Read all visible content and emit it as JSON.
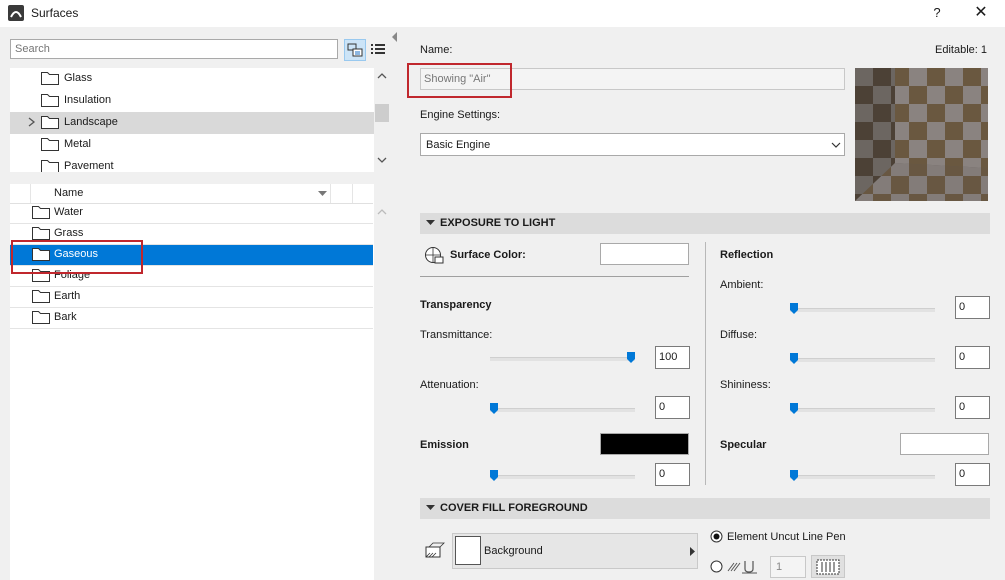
{
  "window": {
    "title": "Surfaces",
    "help": "?",
    "close": "✕"
  },
  "left": {
    "search_placeholder": "Search",
    "tree": [
      {
        "label": "Glass",
        "expandable": false
      },
      {
        "label": "Insulation",
        "expandable": false
      },
      {
        "label": "Landscape",
        "expandable": true,
        "highlighted": true
      },
      {
        "label": "Metal",
        "expandable": false
      },
      {
        "label": "Pavement",
        "expandable": false
      }
    ],
    "list_header": "Name",
    "list": [
      {
        "label": "Water",
        "selected": false
      },
      {
        "label": "Grass",
        "selected": false
      },
      {
        "label": "Gaseous",
        "selected": true
      },
      {
        "label": "Foliage",
        "selected": false
      },
      {
        "label": "Earth",
        "selected": false
      },
      {
        "label": "Bark",
        "selected": false
      }
    ]
  },
  "right": {
    "name_label": "Name:",
    "editable": "Editable: 1",
    "name_value": "Showing \"Air\"",
    "engine_label": "Engine Settings:",
    "engine_value": "Basic Engine",
    "section_exposure": "EXPOSURE TO LIGHT",
    "surface_color_label": "Surface Color:",
    "transparency_label": "Transparency",
    "transmittance_label": "Transmittance:",
    "transmittance_value": "100",
    "attenuation_label": "Attenuation:",
    "attenuation_value": "0",
    "emission_label": "Emission",
    "emission_value": "0",
    "reflection_label": "Reflection",
    "ambient_label": "Ambient:",
    "ambient_value": "0",
    "diffuse_label": "Diffuse:",
    "diffuse_value": "0",
    "shininess_label": "Shininess:",
    "shininess_value": "0",
    "specular_label": "Specular",
    "specular_value": "0",
    "section_cover": "COVER FILL FOREGROUND",
    "fill_value": "Background",
    "pen_option_label": "Element Uncut Line Pen",
    "pen_number": "1"
  },
  "colors": {
    "accent": "#0078d7",
    "highlight_box": "#c0272d",
    "emission_swatch": "#000000"
  }
}
